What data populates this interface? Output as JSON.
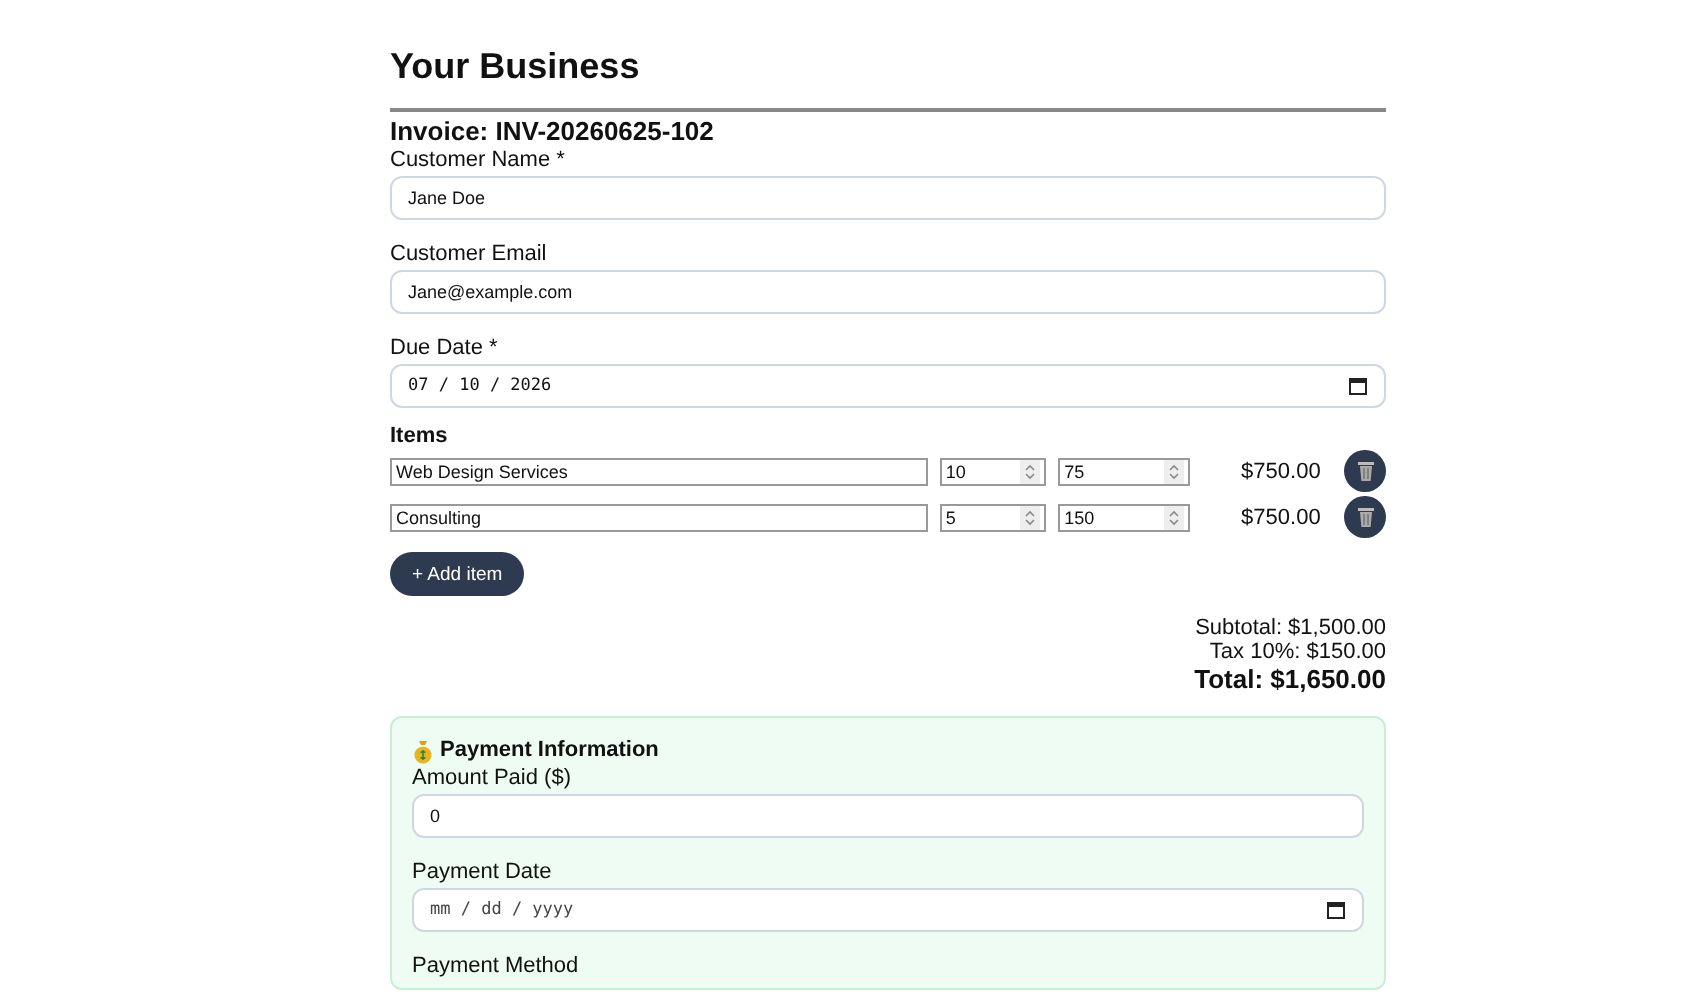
{
  "business_name": "Your Business",
  "invoice_title": "Invoice: INV-20260625-102",
  "fields": [
    {
      "label": "Customer Name *",
      "kind": "text",
      "value": "Jane Doe"
    },
    {
      "label": "Customer Email",
      "kind": "text",
      "value": "Jane@example.com"
    },
    {
      "label": "Due Date *",
      "kind": "date",
      "value": "07 / 10 / 2026"
    }
  ],
  "items_label": "Items",
  "items": [
    {
      "description": "Web Design Services",
      "quantity": "10",
      "price": "75",
      "amount": "$750.00"
    },
    {
      "description": "Consulting",
      "quantity": "5",
      "price": "150",
      "amount": "$750.00"
    }
  ],
  "add_item_button": "+ Add item",
  "totals": {
    "subtotal": "Subtotal: $1,500.00",
    "tax": "Tax 10%: $150.00",
    "total": "Total: $1,650.00"
  },
  "payment": {
    "title": "Payment Information",
    "fields": [
      {
        "label": "Amount Paid ($)",
        "kind": "text",
        "value": "0"
      },
      {
        "label": "Payment Date",
        "kind": "date",
        "placeholder": "mm / dd / yyyy"
      },
      {
        "label": "Payment Method",
        "kind": "label_only"
      }
    ]
  }
}
